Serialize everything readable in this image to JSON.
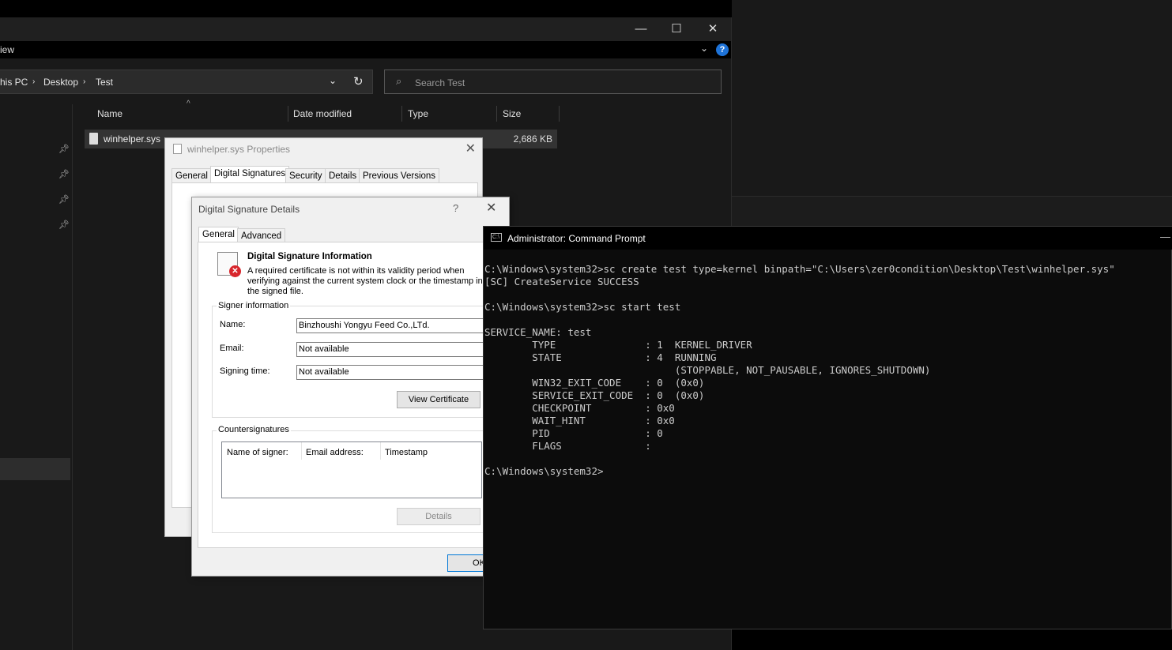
{
  "explorer": {
    "minimize": "—",
    "maximize": "☐",
    "close": "✕",
    "menu_fragment": "iew",
    "breadcrumb": [
      "his PC",
      "Desktop",
      "Test"
    ],
    "search_placeholder": "Search Test",
    "columns": [
      "Name",
      "Date modified",
      "Type",
      "Size"
    ],
    "files": [
      {
        "name": "winhelper.sys",
        "size": "2,686 KB"
      }
    ]
  },
  "properties": {
    "title": "winhelper.sys Properties",
    "tabs": [
      "General",
      "Digital Signatures",
      "Security",
      "Details",
      "Previous Versions"
    ],
    "active_tab": "Digital Signatures"
  },
  "details": {
    "title": "Digital Signature Details",
    "help": "?",
    "tabs": [
      "General",
      "Advanced"
    ],
    "info_heading": "Digital Signature Information",
    "info_text": "A required certificate is not within its validity period when verifying against the current system clock or the timestamp in the signed file.",
    "signer_group": "Signer information",
    "name_label": "Name:",
    "name_value": "Binzhoushi Yongyu Feed Co.,LTd.",
    "email_label": "Email:",
    "email_value": "Not available",
    "time_label": "Signing time:",
    "time_value": "Not available",
    "view_cert_button": "View Certificate",
    "counter_group": "Countersignatures",
    "counter_columns": [
      "Name of signer:",
      "Email address:",
      "Timestamp"
    ],
    "details_button": "Details",
    "ok_button": "OK"
  },
  "cmd": {
    "title": "Administrator: Command Prompt",
    "lines": [
      "C:\\Windows\\system32>sc create test type=kernel binpath=\"C:\\Users\\zer0condition\\Desktop\\Test\\winhelper.sys\"",
      "[SC] CreateService SUCCESS",
      "",
      "C:\\Windows\\system32>sc start test",
      "",
      "SERVICE_NAME: test",
      "        TYPE               : 1  KERNEL_DRIVER",
      "        STATE              : 4  RUNNING",
      "                                (STOPPABLE, NOT_PAUSABLE, IGNORES_SHUTDOWN)",
      "        WIN32_EXIT_CODE    : 0  (0x0)",
      "        SERVICE_EXIT_CODE  : 0  (0x0)",
      "        CHECKPOINT         : 0x0",
      "        WAIT_HINT          : 0x0",
      "        PID                : 0",
      "        FLAGS              :",
      "",
      "C:\\Windows\\system32>"
    ]
  }
}
